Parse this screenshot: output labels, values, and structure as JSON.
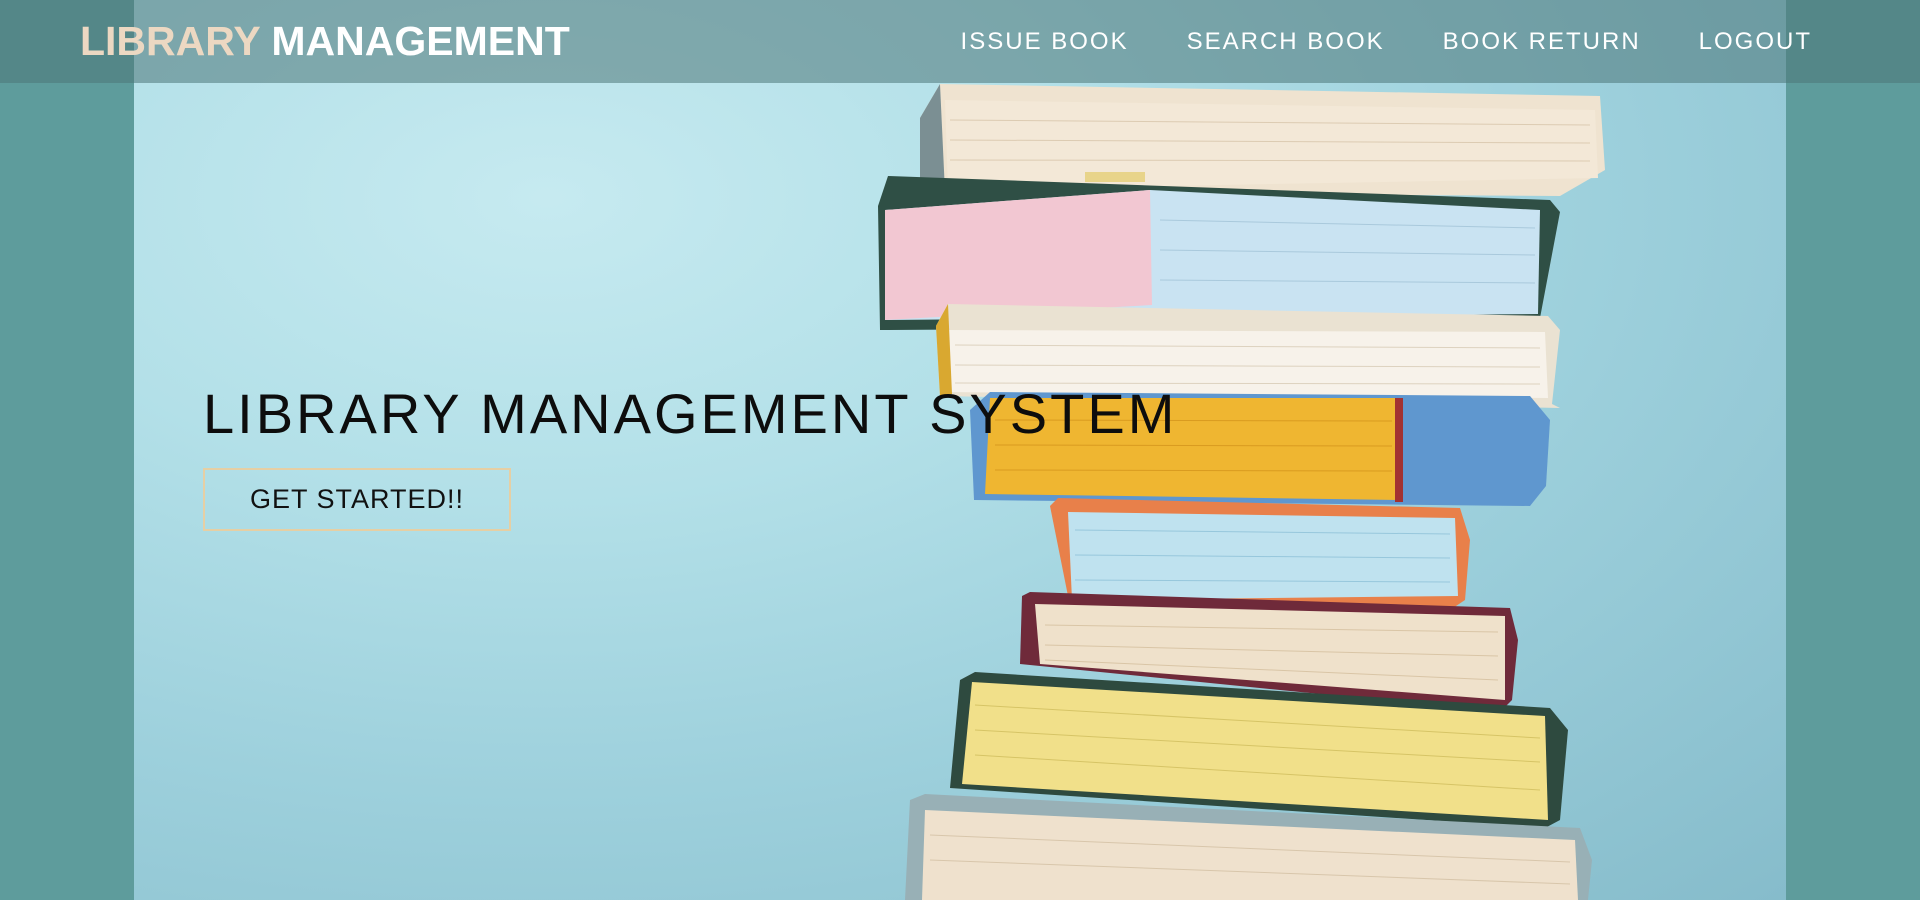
{
  "brand": {
    "part1": "LIBRARY",
    "part2": "MANAGEMENT"
  },
  "nav": {
    "items": [
      {
        "label": "ISSUE BOOK"
      },
      {
        "label": "SEARCH BOOK"
      },
      {
        "label": "BOOK RETURN"
      },
      {
        "label": "LOGOUT"
      }
    ]
  },
  "hero": {
    "title": "LIBRARY MANAGEMENT SYSTEM",
    "cta_label": "GET STARTED!!",
    "illustration": "book-stack-image"
  },
  "colors": {
    "page_bg": "#5e9c9c",
    "hero_bg": "#b3e0e8",
    "brand_accent": "#ecd8c2",
    "cta_border": "#e6cfa4",
    "nav_text": "#ffffff"
  }
}
